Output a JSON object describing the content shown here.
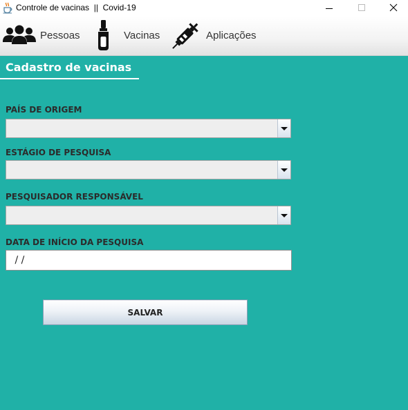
{
  "window": {
    "title": "Controle de vacinas  ||  Covid-19",
    "icon": "java-cup-icon"
  },
  "menu": {
    "items": [
      {
        "label": "Pessoas",
        "icon": "people-icon"
      },
      {
        "label": "Vacinas",
        "icon": "vial-icon"
      },
      {
        "label": "Aplicações",
        "icon": "syringe-icon"
      }
    ]
  },
  "form": {
    "title": "Cadastro de vacinas",
    "country_label": "PAÍS DE ORIGEM",
    "country_value": "",
    "stage_label": "ESTÁGIO DE PESQUISA",
    "stage_value": "",
    "researcher_label": "PESQUISADOR RESPONSÁVEL",
    "researcher_value": "",
    "date_label": "DATA DE INÍCIO DA PESQUISA",
    "date_value": " / /",
    "save_label": "SALVAR"
  },
  "colors": {
    "background": "#20b1a7",
    "title_text": "#ffffff"
  }
}
